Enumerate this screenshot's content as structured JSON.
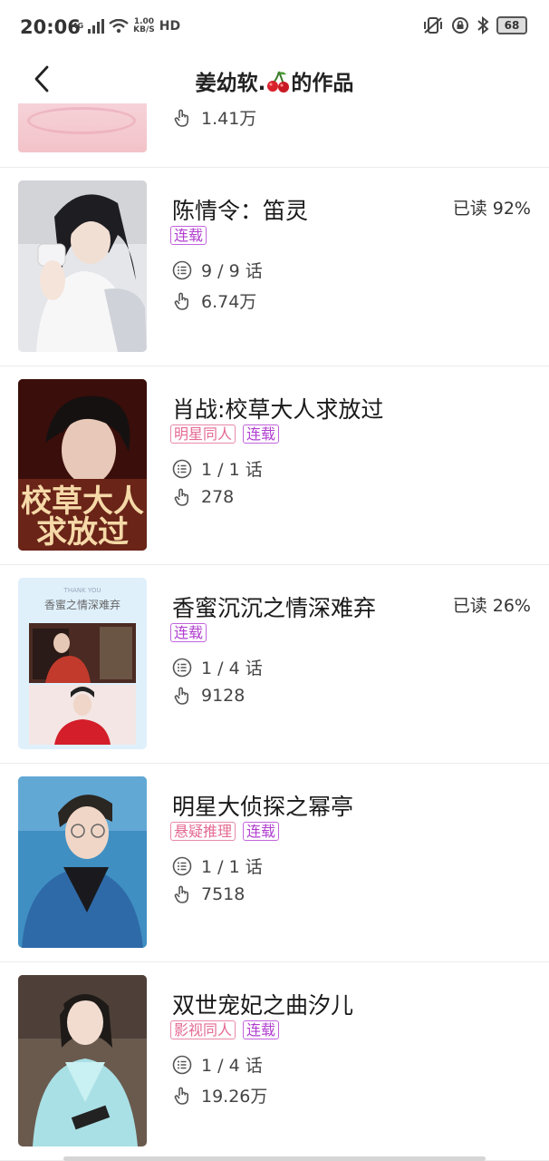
{
  "status_bar": {
    "time": "20:06",
    "network": "4G",
    "speed_value": "1.00",
    "speed_unit": "KB/S",
    "hd": "HD",
    "battery": "68"
  },
  "header": {
    "title_prefix": "姜幼软.",
    "title_suffix": "的作品",
    "back_icon": "chevron-left-icon"
  },
  "partial_item": {
    "likes": "1.41万"
  },
  "items": [
    {
      "title": "陈情令：笛灵",
      "progress": "已读 92%",
      "tags": [
        {
          "label": "连载",
          "style": "purple"
        }
      ],
      "chapters": "9 / 9 话",
      "likes": "6.74万"
    },
    {
      "title": "肖战:校草大人求放过",
      "progress": "",
      "tags": [
        {
          "label": "明星同人",
          "style": "pink"
        },
        {
          "label": "连载",
          "style": "purple"
        }
      ],
      "chapters": "1 / 1 话",
      "likes": "278",
      "cover_text": [
        "校草大人",
        "求放过"
      ]
    },
    {
      "title": "香蜜沉沉之情深难弃",
      "progress": "已读 26%",
      "tags": [
        {
          "label": "连载",
          "style": "purple"
        }
      ],
      "chapters": "1 / 4 话",
      "likes": "9128",
      "cover_text": [
        "THANK YOU",
        "香蜜之情深难弃"
      ]
    },
    {
      "title": "明星大侦探之幂亭",
      "progress": "",
      "tags": [
        {
          "label": "悬疑推理",
          "style": "pink"
        },
        {
          "label": "连载",
          "style": "purple"
        }
      ],
      "chapters": "1 / 1 话",
      "likes": "7518"
    },
    {
      "title": "双世宠妃之曲汐儿",
      "progress": "",
      "tags": [
        {
          "label": "影视同人",
          "style": "pink"
        },
        {
          "label": "连载",
          "style": "purple"
        }
      ],
      "chapters": "1 / 4 话",
      "likes": "19.26万"
    }
  ]
}
